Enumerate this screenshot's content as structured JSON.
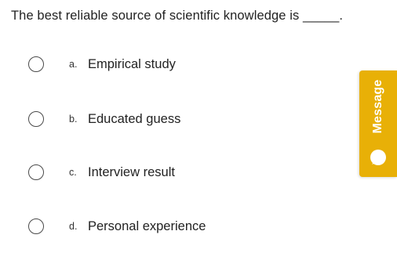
{
  "question": {
    "text": "The best reliable source of scientific knowledge is _____."
  },
  "options": [
    {
      "letter": "a.",
      "label": "Empirical study"
    },
    {
      "letter": "b.",
      "label": "Educated guess"
    },
    {
      "letter": "c.",
      "label": "Interview result"
    },
    {
      "letter": "d.",
      "label": "Personal experience"
    }
  ],
  "message_tab": {
    "label": "Message",
    "icon": "chat-bubble-icon",
    "color": "#e8b007"
  }
}
